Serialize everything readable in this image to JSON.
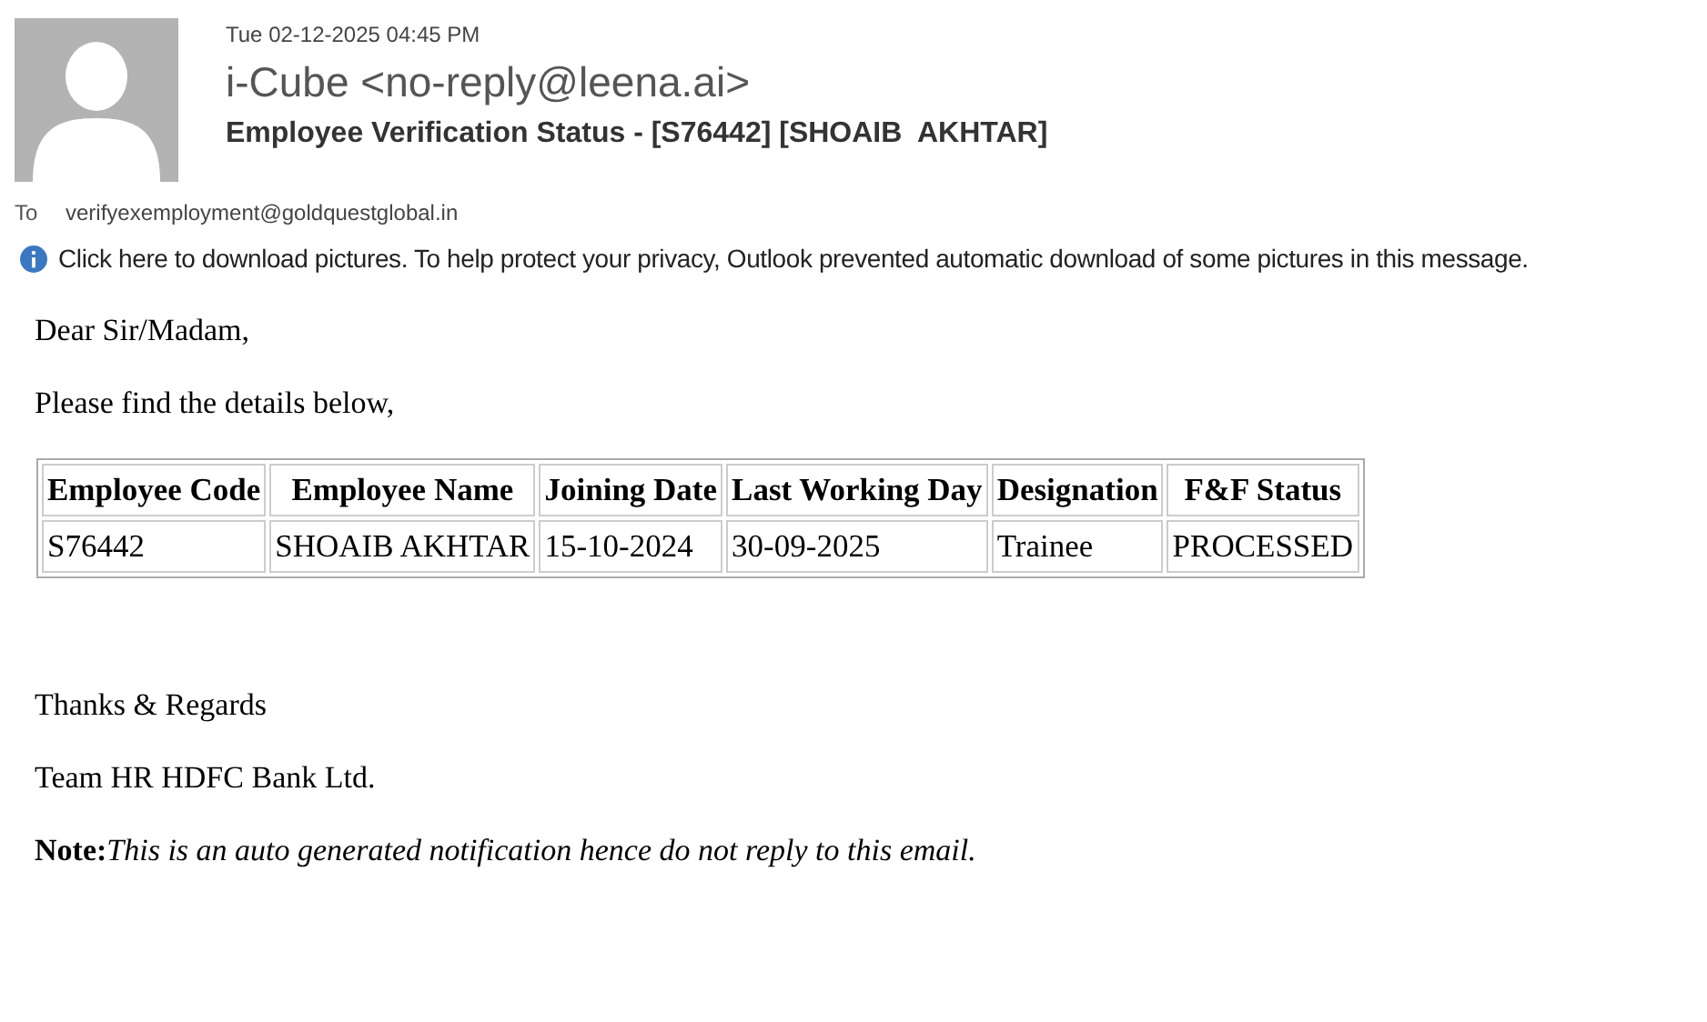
{
  "header": {
    "date": "Tue 02-12-2025 04:45 PM",
    "sender": "i-Cube <no-reply@leena.ai>",
    "subject": "Employee Verification Status - [S76442] [SHOAIB  AKHTAR]",
    "to_label": "To",
    "to": "verifyexemployment@goldquestglobal.in"
  },
  "info_bar": "Click here to download pictures. To help protect your privacy, Outlook prevented automatic download of some pictures in this message.",
  "body": {
    "greeting": "Dear Sir/Madam,",
    "intro": "Please find the details below,",
    "table": {
      "columns": [
        "Employee Code",
        "Employee Name",
        "Joining Date",
        "Last Working Day",
        "Designation",
        "F&F Status"
      ],
      "rows": [
        [
          "S76442",
          "SHOAIB AKHTAR",
          "15-10-2024",
          "30-09-2025",
          "Trainee",
          "PROCESSED"
        ]
      ]
    },
    "closing": "Thanks & Regards",
    "signature": "Team HR HDFC Bank Ltd.",
    "note": "**Note:**This is an auto generated notification hence do not reply to this email."
  }
}
